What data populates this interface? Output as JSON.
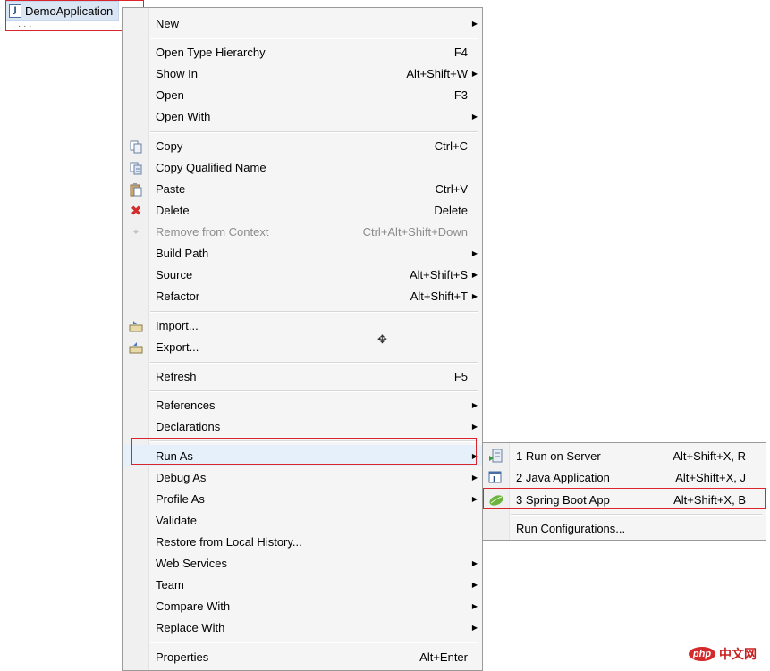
{
  "tree": {
    "file_label": "DemoApplication"
  },
  "menu": {
    "items": [
      {
        "label": "New",
        "shortcut": "",
        "submenu": true
      },
      {
        "label": "Open Type Hierarchy",
        "shortcut": "F4",
        "submenu": false
      },
      {
        "label": "Show In",
        "shortcut": "Alt+Shift+W",
        "submenu": true
      },
      {
        "label": "Open",
        "shortcut": "F3",
        "submenu": false
      },
      {
        "label": "Open With",
        "shortcut": "",
        "submenu": true
      },
      {
        "label": "Copy",
        "shortcut": "Ctrl+C",
        "submenu": false,
        "icon": "copy-icon"
      },
      {
        "label": "Copy Qualified Name",
        "shortcut": "",
        "submenu": false,
        "icon": "copy-qualified-name-icon"
      },
      {
        "label": "Paste",
        "shortcut": "Ctrl+V",
        "submenu": false,
        "icon": "paste-icon"
      },
      {
        "label": "Delete",
        "shortcut": "Delete",
        "submenu": false,
        "icon": "delete-icon"
      },
      {
        "label": "Remove from Context",
        "shortcut": "Ctrl+Alt+Shift+Down",
        "submenu": false,
        "icon": "remove-context-icon",
        "disabled": true
      },
      {
        "label": "Build Path",
        "shortcut": "",
        "submenu": true
      },
      {
        "label": "Source",
        "shortcut": "Alt+Shift+S",
        "submenu": true
      },
      {
        "label": "Refactor",
        "shortcut": "Alt+Shift+T",
        "submenu": true
      },
      {
        "label": "Import...",
        "shortcut": "",
        "submenu": false,
        "icon": "import-icon"
      },
      {
        "label": "Export...",
        "shortcut": "",
        "submenu": false,
        "icon": "export-icon"
      },
      {
        "label": "Refresh",
        "shortcut": "F5",
        "submenu": false
      },
      {
        "label": "References",
        "shortcut": "",
        "submenu": true
      },
      {
        "label": "Declarations",
        "shortcut": "",
        "submenu": true
      },
      {
        "label": "Run As",
        "shortcut": "",
        "submenu": true,
        "highlighted": true
      },
      {
        "label": "Debug As",
        "shortcut": "",
        "submenu": true
      },
      {
        "label": "Profile As",
        "shortcut": "",
        "submenu": true
      },
      {
        "label": "Validate",
        "shortcut": "",
        "submenu": false
      },
      {
        "label": "Restore from Local History...",
        "shortcut": "",
        "submenu": false
      },
      {
        "label": "Web Services",
        "shortcut": "",
        "submenu": true
      },
      {
        "label": "Team",
        "shortcut": "",
        "submenu": true
      },
      {
        "label": "Compare With",
        "shortcut": "",
        "submenu": true
      },
      {
        "label": "Replace With",
        "shortcut": "",
        "submenu": true
      },
      {
        "label": "Properties",
        "shortcut": "Alt+Enter",
        "submenu": false
      }
    ]
  },
  "submenu": {
    "items": [
      {
        "label": "1 Run on Server",
        "shortcut": "Alt+Shift+X, R",
        "icon": "run-on-server-icon"
      },
      {
        "label": "2 Java Application",
        "shortcut": "Alt+Shift+X, J",
        "icon": "java-application-icon"
      },
      {
        "label": "3 Spring Boot App",
        "shortcut": "Alt+Shift+X, B",
        "icon": "spring-boot-icon"
      },
      {
        "label": "Run Configurations...",
        "shortcut": ""
      }
    ]
  },
  "watermark": {
    "logo": "php",
    "site": "中文网"
  },
  "colors": {
    "highlight_box": "#d9262c",
    "menu_bg": "#f5f5f5"
  }
}
